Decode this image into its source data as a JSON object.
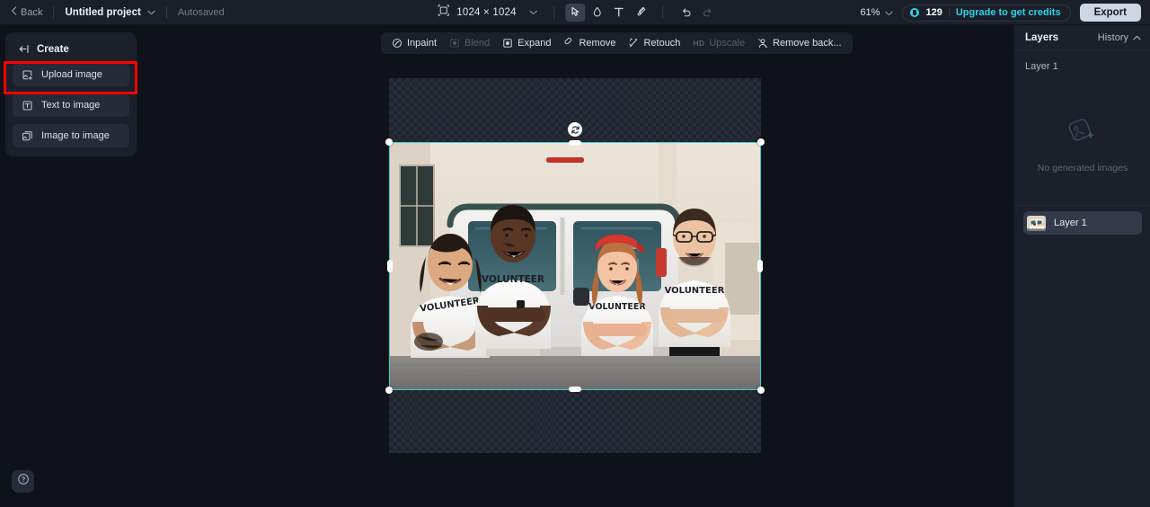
{
  "topbar": {
    "back_label": "Back",
    "project_name": "Untitled project",
    "project_chevron_icon": "chevron-down-icon",
    "autosaved_label": "Autosaved",
    "canvas_size_icon": "canvas-size-icon",
    "canvas_size_label": "1024 × 1024",
    "canvas_size_chevron_icon": "chevron-down-icon",
    "tools": [
      {
        "name": "select-tool",
        "icon": "cursor-arrow-icon",
        "active": true,
        "disabled": false
      },
      {
        "name": "shape-tool",
        "icon": "blob-shape-icon",
        "active": false,
        "disabled": false
      },
      {
        "name": "text-tool",
        "icon": "text-t-icon",
        "active": false,
        "disabled": false
      },
      {
        "name": "brush-tool",
        "icon": "paintbrush-icon",
        "active": false,
        "disabled": false
      },
      {
        "name": "undo-tool",
        "icon": "undo-arrow-icon",
        "active": false,
        "disabled": false
      },
      {
        "name": "redo-tool",
        "icon": "redo-arrow-icon",
        "active": false,
        "disabled": true
      }
    ],
    "zoom_level": "61%",
    "zoom_chevron_icon": "chevron-down-icon",
    "credits_icon": "coin-icon",
    "credits_count": "129",
    "upgrade_label": "Upgrade to get credits",
    "export_label": "Export"
  },
  "sidebar": {
    "collapse_icon": "collapse-panel-icon",
    "create_label": "Create",
    "items": [
      {
        "label": "Upload image",
        "icon": "upload-image-icon",
        "highlighted": true
      },
      {
        "label": "Text to image",
        "icon": "text-to-image-icon",
        "highlighted": false
      },
      {
        "label": "Image to image",
        "icon": "image-to-image-icon",
        "highlighted": false
      }
    ],
    "help_icon": "question-mark-help-icon"
  },
  "edit_toolbar": {
    "items": [
      {
        "label": "Inpaint",
        "icon": "inpaint-icon",
        "disabled": false
      },
      {
        "label": "Blend",
        "icon": "blend-icon",
        "disabled": true
      },
      {
        "label": "Expand",
        "icon": "expand-icon",
        "disabled": false
      },
      {
        "label": "Remove",
        "icon": "eraser-icon",
        "disabled": false
      },
      {
        "label": "Retouch",
        "icon": "retouch-icon",
        "disabled": false
      },
      {
        "label": "Upscale",
        "badge": "HD",
        "icon": "hd-upscale-icon",
        "disabled": true
      },
      {
        "label": "Remove back...",
        "icon": "remove-background-icon",
        "disabled": false
      }
    ]
  },
  "canvas": {
    "selection": {
      "rotate_icon": "rotate-handle-icon",
      "handle_count": 8,
      "border_color": "#2fd4d0"
    },
    "image_alt": "Four volunteers in white VOLUNTEER t-shirts standing in front of a white van"
  },
  "right_panel": {
    "title": "Layers",
    "history_label": "History",
    "history_chevron_icon": "chevron-up-icon",
    "active_layer_label": "Layer 1",
    "empty_state_icon": "no-images-placeholder-icon",
    "empty_state_text": "No generated images",
    "layers": [
      {
        "label": "Layer 1",
        "thumb": "volunteers-photo-thumb"
      }
    ]
  },
  "colors": {
    "accent_cyan": "#2ad4e8",
    "selection_teal": "#2fd4d0",
    "annotation_red": "#ff0000",
    "panel_bg": "#1b202b",
    "app_bg": "#0f1319"
  }
}
